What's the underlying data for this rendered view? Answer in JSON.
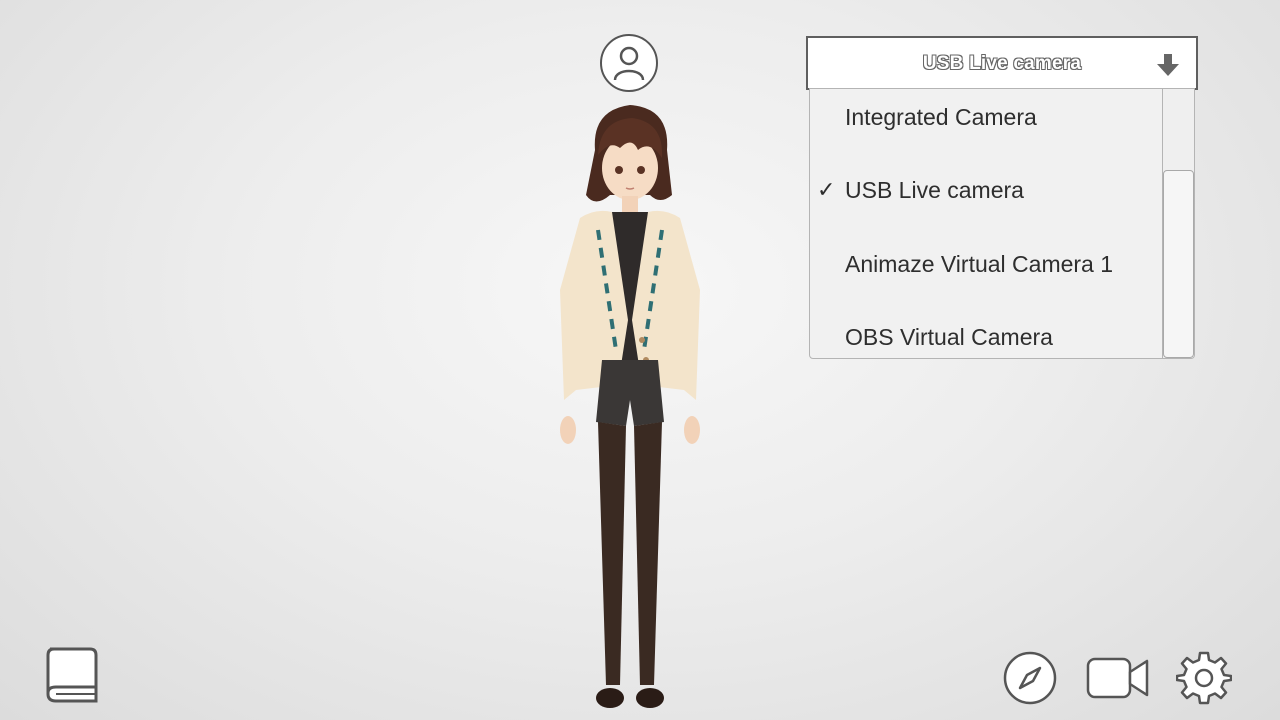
{
  "profile": {
    "icon": "user-icon"
  },
  "camera_selector": {
    "selected": "USB  Live camera",
    "arrow_icon": "arrow-down-icon",
    "options": [
      {
        "label": "Integrated Camera",
        "checked": false
      },
      {
        "label": "USB  Live camera",
        "checked": true
      },
      {
        "label": "Animaze Virtual Camera 1",
        "checked": false
      },
      {
        "label": "OBS Virtual Camera",
        "checked": false
      }
    ],
    "check_glyph": "✓"
  },
  "bottom_toolbar": {
    "left": [
      {
        "icon": "book-icon"
      }
    ],
    "right": [
      {
        "icon": "compass-icon"
      },
      {
        "icon": "video-camera-icon"
      },
      {
        "icon": "gear-icon"
      }
    ]
  },
  "colors": {
    "outline": "#555555",
    "panel": "#f1f1f1",
    "text": "#2e2e2e"
  }
}
